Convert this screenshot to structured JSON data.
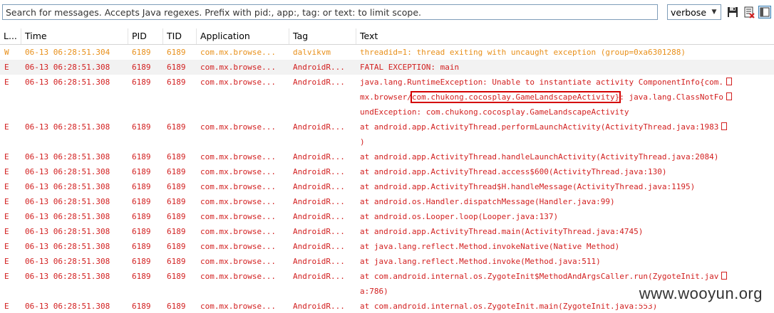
{
  "toolbar": {
    "search_placeholder": "Search for messages. Accepts Java regexes. Prefix with pid:, app:, tag: or text: to limit scope.",
    "level_selected": "verbose",
    "save_icon": "floppy-disk-icon",
    "clear_icon": "clear-log-icon",
    "toggle_icon": "toggle-filters-panel-icon"
  },
  "columns": {
    "level": "L...",
    "time": "Time",
    "pid": "PID",
    "tid": "TID",
    "application": "Application",
    "tag": "Tag",
    "text": "Text"
  },
  "colors": {
    "warn": "#e8901b",
    "error": "#d21f1f",
    "highlight_box": "#d40000"
  },
  "rows": [
    {
      "level": "W",
      "time": "06-13 06:28:51.304",
      "pid": "6189",
      "tid": "6189",
      "app": "com.mx.browse...",
      "tag": "dalvikvm",
      "lines": [
        "threadid=1: thread exiting with uncaught exception (group=0xa6301288)"
      ]
    },
    {
      "level": "E",
      "time": "06-13 06:28:51.308",
      "pid": "6189",
      "tid": "6189",
      "app": "com.mx.browse...",
      "tag": "AndroidR...",
      "lines": [
        "FATAL EXCEPTION: main"
      ]
    },
    {
      "level": "E",
      "time": "06-13 06:28:51.308",
      "pid": "6189",
      "tid": "6189",
      "app": "com.mx.browse...",
      "tag": "AndroidR...",
      "lines": [
        "java.lang.RuntimeException: Unable to instantiate activity ComponentInfo{com.",
        "mx.browser/",
        "undException: com.chukong.cocosplay.GameLandscapeActivity"
      ],
      "highlight": "com.chukong.cocosplay.GameLandscapeActivity}",
      "after_highlight": ": java.lang.ClassNotFo"
    },
    {
      "level": "E",
      "time": "06-13 06:28:51.308",
      "pid": "6189",
      "tid": "6189",
      "app": "com.mx.browse...",
      "tag": "AndroidR...",
      "lines": [
        "at android.app.ActivityThread.performLaunchActivity(ActivityThread.java:1983",
        ")"
      ]
    },
    {
      "level": "E",
      "time": "06-13 06:28:51.308",
      "pid": "6189",
      "tid": "6189",
      "app": "com.mx.browse...",
      "tag": "AndroidR...",
      "lines": [
        "at android.app.ActivityThread.handleLaunchActivity(ActivityThread.java:2084)"
      ]
    },
    {
      "level": "E",
      "time": "06-13 06:28:51.308",
      "pid": "6189",
      "tid": "6189",
      "app": "com.mx.browse...",
      "tag": "AndroidR...",
      "lines": [
        "at android.app.ActivityThread.access$600(ActivityThread.java:130)"
      ]
    },
    {
      "level": "E",
      "time": "06-13 06:28:51.308",
      "pid": "6189",
      "tid": "6189",
      "app": "com.mx.browse...",
      "tag": "AndroidR...",
      "lines": [
        "at android.app.ActivityThread$H.handleMessage(ActivityThread.java:1195)"
      ]
    },
    {
      "level": "E",
      "time": "06-13 06:28:51.308",
      "pid": "6189",
      "tid": "6189",
      "app": "com.mx.browse...",
      "tag": "AndroidR...",
      "lines": [
        "at android.os.Handler.dispatchMessage(Handler.java:99)"
      ]
    },
    {
      "level": "E",
      "time": "06-13 06:28:51.308",
      "pid": "6189",
      "tid": "6189",
      "app": "com.mx.browse...",
      "tag": "AndroidR...",
      "lines": [
        "at android.os.Looper.loop(Looper.java:137)"
      ]
    },
    {
      "level": "E",
      "time": "06-13 06:28:51.308",
      "pid": "6189",
      "tid": "6189",
      "app": "com.mx.browse...",
      "tag": "AndroidR...",
      "lines": [
        "at android.app.ActivityThread.main(ActivityThread.java:4745)"
      ]
    },
    {
      "level": "E",
      "time": "06-13 06:28:51.308",
      "pid": "6189",
      "tid": "6189",
      "app": "com.mx.browse...",
      "tag": "AndroidR...",
      "lines": [
        "at java.lang.reflect.Method.invokeNative(Native Method)"
      ]
    },
    {
      "level": "E",
      "time": "06-13 06:28:51.308",
      "pid": "6189",
      "tid": "6189",
      "app": "com.mx.browse...",
      "tag": "AndroidR...",
      "lines": [
        "at java.lang.reflect.Method.invoke(Method.java:511)"
      ]
    },
    {
      "level": "E",
      "time": "06-13 06:28:51.308",
      "pid": "6189",
      "tid": "6189",
      "app": "com.mx.browse...",
      "tag": "AndroidR...",
      "lines": [
        "at com.android.internal.os.ZygoteInit$MethodAndArgsCaller.run(ZygoteInit.jav",
        "a:786)"
      ]
    },
    {
      "level": "E",
      "time": "06-13 06:28:51.308",
      "pid": "6189",
      "tid": "6189",
      "app": "com.mx.browse...",
      "tag": "AndroidR...",
      "lines": [
        "at com.android.internal.os.ZygoteInit.main(ZygoteInit.java:553)"
      ]
    }
  ],
  "watermark": "www.wooyun.org"
}
